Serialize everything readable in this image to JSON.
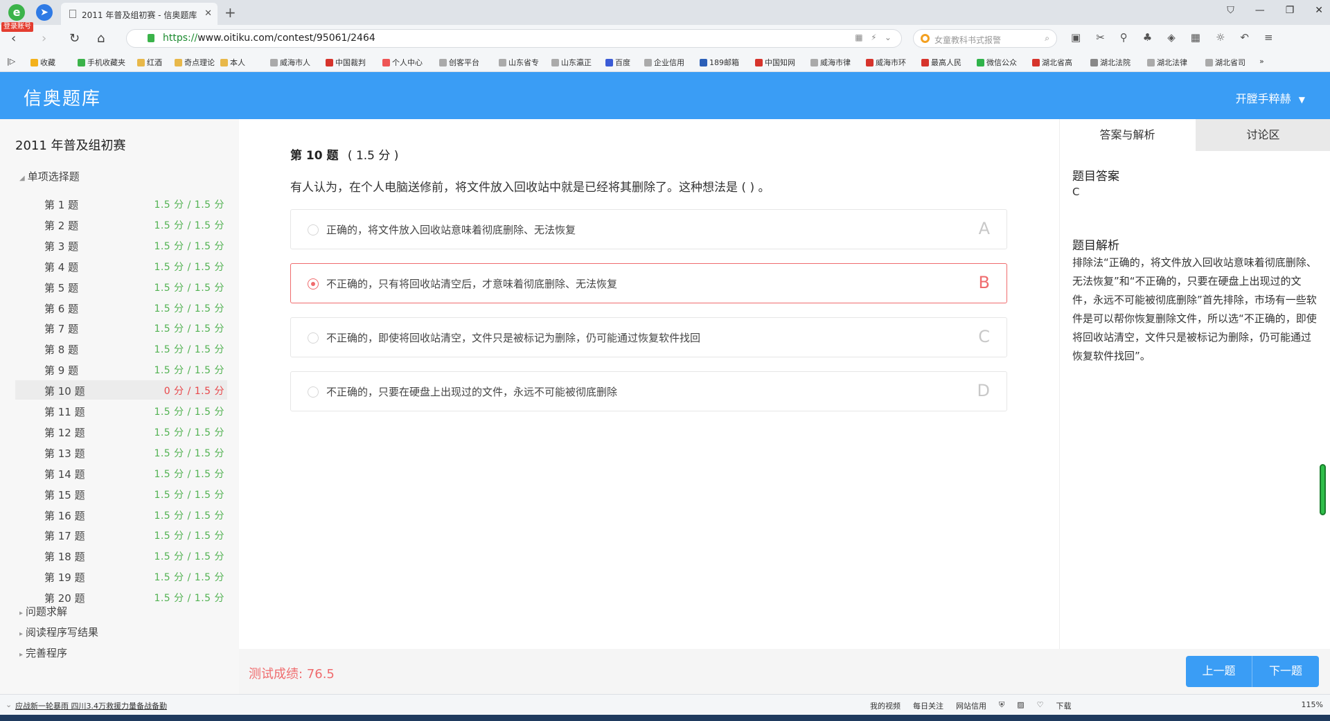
{
  "browser": {
    "login_badge": "登录账号",
    "tab_title": "2011 年普及组初赛 - 信奥题库",
    "url_protocol": "https://",
    "url_rest": "www.oitiku.com/contest/95061/2464",
    "search_placeholder": "女童教科书式报警",
    "bookmarks": [
      "收藏",
      "手机收藏夹",
      "红酒",
      "奇点理论",
      "本人",
      "威海市人",
      "中国裁判",
      "个人中心",
      "创客平台",
      "山东省专",
      "山东瀛正",
      "百度",
      "企业信用",
      "189邮箱",
      "中国知网",
      "威海市律",
      "威海市环",
      "最高人民",
      "微信公众",
      "湖北省高",
      "湖北法院",
      "湖北法律",
      "湖北省司"
    ]
  },
  "site": {
    "logo": "信奥题库",
    "user_name": "开膛手粹赫"
  },
  "sidebar": {
    "contest_title": "2011 年普及组初赛",
    "section_single": "单项选择题",
    "questions": [
      {
        "label": "第 1 题",
        "score": "1.5 分 / 1.5 分"
      },
      {
        "label": "第 2 题",
        "score": "1.5 分 / 1.5 分"
      },
      {
        "label": "第 3 题",
        "score": "1.5 分 / 1.5 分"
      },
      {
        "label": "第 4 题",
        "score": "1.5 分 / 1.5 分"
      },
      {
        "label": "第 5 题",
        "score": "1.5 分 / 1.5 分"
      },
      {
        "label": "第 6 题",
        "score": "1.5 分 / 1.5 分"
      },
      {
        "label": "第 7 题",
        "score": "1.5 分 / 1.5 分"
      },
      {
        "label": "第 8 题",
        "score": "1.5 分 / 1.5 分"
      },
      {
        "label": "第 9 题",
        "score": "1.5 分 / 1.5 分"
      },
      {
        "label": "第 10 题",
        "score": "0 分 / 1.5 分"
      },
      {
        "label": "第 11 题",
        "score": "1.5 分 / 1.5 分"
      },
      {
        "label": "第 12 题",
        "score": "1.5 分 / 1.5 分"
      },
      {
        "label": "第 13 题",
        "score": "1.5 分 / 1.5 分"
      },
      {
        "label": "第 14 题",
        "score": "1.5 分 / 1.5 分"
      },
      {
        "label": "第 15 题",
        "score": "1.5 分 / 1.5 分"
      },
      {
        "label": "第 16 题",
        "score": "1.5 分 / 1.5 分"
      },
      {
        "label": "第 17 题",
        "score": "1.5 分 / 1.5 分"
      },
      {
        "label": "第 18 题",
        "score": "1.5 分 / 1.5 分"
      },
      {
        "label": "第 19 题",
        "score": "1.5 分 / 1.5 分"
      },
      {
        "label": "第 20 题",
        "score": "1.5 分 / 1.5 分"
      }
    ],
    "section_qa": "问题求解",
    "section_read": "阅读程序写结果",
    "section_complete": "完善程序"
  },
  "question": {
    "number_label": "第 10 题",
    "points": "( 1.5 分 )",
    "stem": "有人认为，在个人电脑送修前，将文件放入回收站中就是已经将其删除了。这种想法是 ( ) 。",
    "options": [
      {
        "letter": "A",
        "text": "正确的，将文件放入回收站意味着彻底删除、无法恢复"
      },
      {
        "letter": "B",
        "text": "不正确的，只有将回收站清空后，才意味着彻底删除、无法恢复"
      },
      {
        "letter": "C",
        "text": "不正确的，即使将回收站清空，文件只是被标记为删除，仍可能通过恢复软件找回"
      },
      {
        "letter": "D",
        "text": "不正确的，只要在硬盘上出现过的文件，永远不可能被彻底删除"
      }
    ],
    "selected": "B"
  },
  "footer": {
    "score_text": "测试成绩: 76.5",
    "prev_label": "上一题",
    "next_label": "下一题"
  },
  "answer_panel": {
    "tab_answer": "答案与解析",
    "tab_discuss": "讨论区",
    "answer_title": "题目答案",
    "answer_value": "C",
    "explanation_title": "题目解析",
    "explanation": "排除法“正确的，将文件放入回收站意味着彻底删除、无法恢复”和“不正确的，只要在硬盘上出现过的文件，永远不可能被彻底删除”首先排除，市场有一些软件是可以帮你恢复删除文件，所以选“不正确的，即使将回收站清空，文件只是被标记为删除，仍可能通过恢复软件找回”。"
  },
  "statusbar": {
    "news": "应战新一轮暴雨 四川3.4万救援力量备战备勤",
    "items": [
      "我的视频",
      "每日关注",
      "网站信用",
      "下载"
    ],
    "zoom": "115%"
  },
  "colors": {
    "brand_blue": "#3a9df5",
    "correct_green": "#52b252",
    "wrong_red": "#e8474a",
    "selected_red": "#ef6b6d"
  }
}
